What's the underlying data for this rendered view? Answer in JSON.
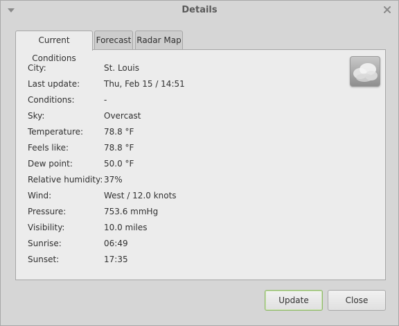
{
  "window": {
    "title": "Details"
  },
  "icons": {
    "menu": "chevron-down-icon",
    "close": "close-icon",
    "sky": "overcast-cloud-icon"
  },
  "tabs": [
    {
      "label": "Current Conditions",
      "active": true
    },
    {
      "label": "Forecast",
      "active": false
    },
    {
      "label": "Radar Map",
      "active": false
    }
  ],
  "conditions": [
    {
      "label": "City:",
      "value": "St. Louis"
    },
    {
      "label": "Last update:",
      "value": "Thu, Feb 15 / 14:51"
    },
    {
      "label": "Conditions:",
      "value": "-"
    },
    {
      "label": "Sky:",
      "value": "Overcast"
    },
    {
      "label": "Temperature:",
      "value": "78.8 °F"
    },
    {
      "label": "Feels like:",
      "value": "78.8 °F"
    },
    {
      "label": "Dew point:",
      "value": "50.0 °F"
    },
    {
      "label": "Relative humidity:",
      "value": "37%"
    },
    {
      "label": "Wind:",
      "value": "West / 12.0 knots"
    },
    {
      "label": "Pressure:",
      "value": "753.6 mmHg"
    },
    {
      "label": "Visibility:",
      "value": "10.0 miles"
    },
    {
      "label": "Sunrise:",
      "value": "06:49"
    },
    {
      "label": "Sunset:",
      "value": "17:35"
    }
  ],
  "buttons": {
    "update": "Update",
    "close": "Close"
  },
  "colors": {
    "window_bg": "#d6d6d6",
    "panel_bg": "#ececec",
    "default_button_border": "#8fb86a"
  }
}
